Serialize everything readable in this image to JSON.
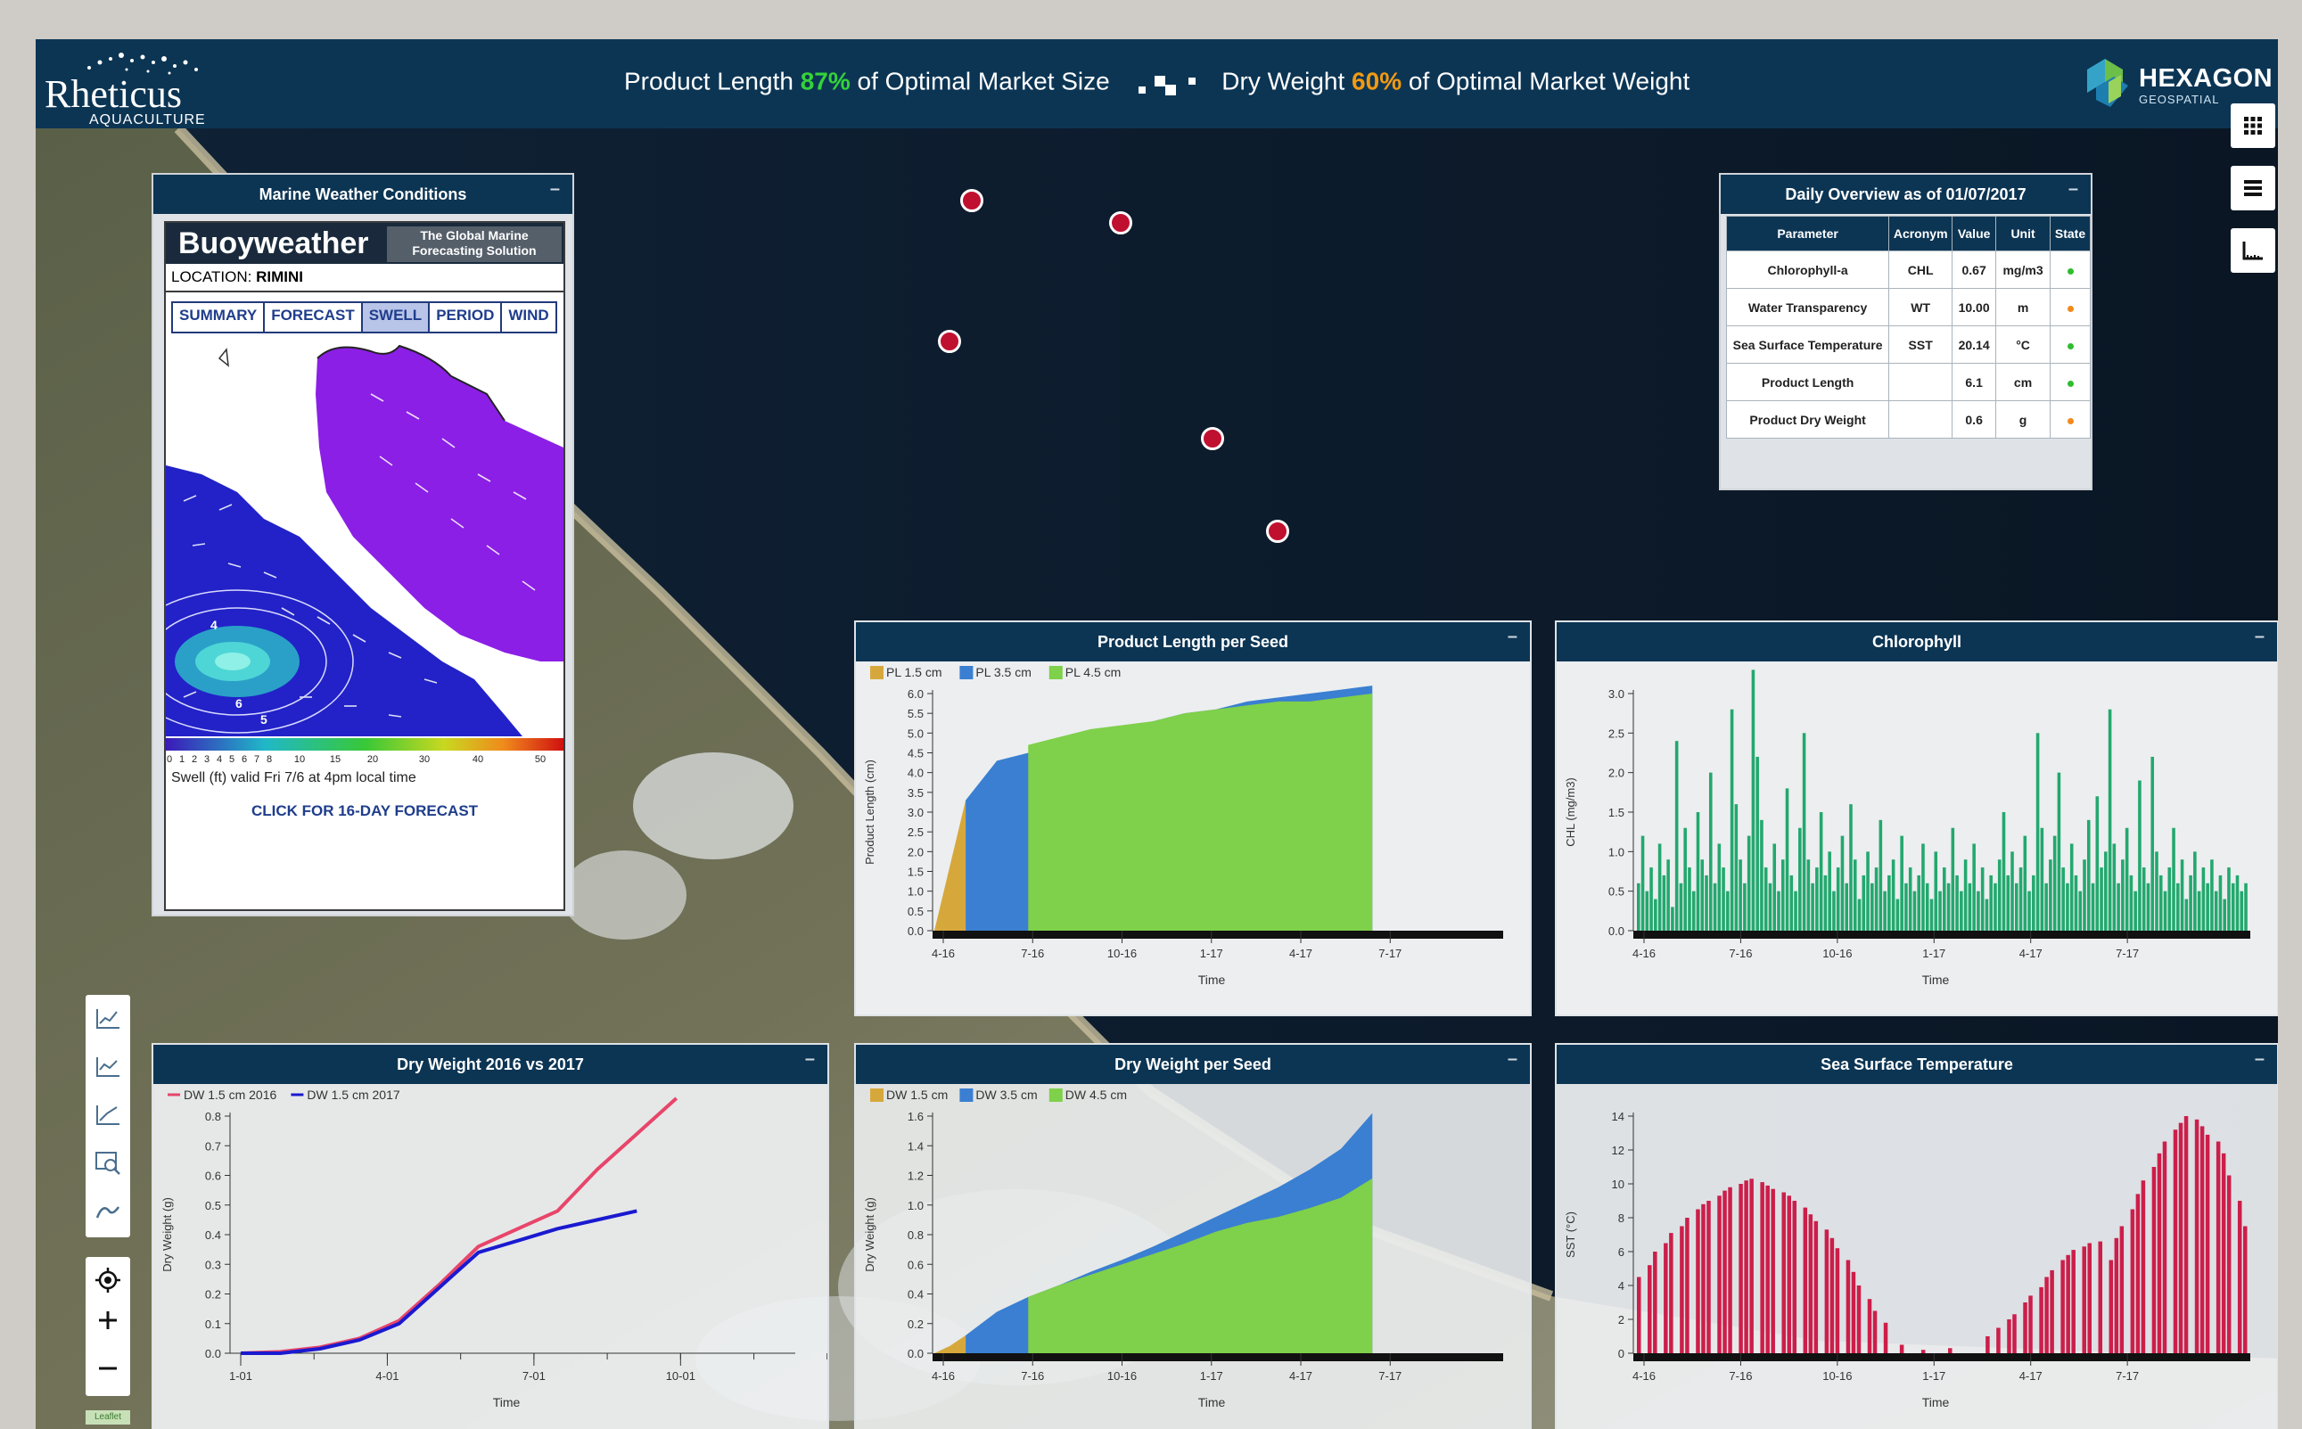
{
  "header": {
    "logo_name": "Rheticus",
    "logo_sub": "AQUACULTURE",
    "length_prefix": "Product Length ",
    "length_pct": "87%",
    "length_suffix": " of Optimal Market Size",
    "weight_prefix": "Dry Weight ",
    "weight_pct": "60%",
    "weight_suffix": " of Optimal Market Weight",
    "partner_logo": "HEXAGON",
    "partner_sub": "GEOSPATIAL"
  },
  "weather": {
    "title": "Marine Weather Conditions",
    "brand": "Buoyweather",
    "tagline_1": "The Global Marine",
    "tagline_2": "Forecasting Solution",
    "location_label": "LOCATION:",
    "location_value": "RIMINI",
    "tabs": [
      "SUMMARY",
      "FORECAST",
      "SWELL",
      "PERIOD",
      "WIND"
    ],
    "selected_tab": "SWELL",
    "scale_ticks": [
      "0",
      "1",
      "2",
      "3",
      "4",
      "5",
      "6",
      "7",
      "8",
      "10",
      "15",
      "20",
      "30",
      "40",
      "50"
    ],
    "contour_labels": [
      "4",
      "6",
      "5"
    ],
    "caption": "Swell (ft) valid Fri 7/6 at 4pm local time",
    "forecast_link": "CLICK FOR 16-DAY FORECAST"
  },
  "overview": {
    "title": "Daily Overview as of 01/07/2017",
    "columns": [
      "Parameter",
      "Acronym",
      "Value",
      "Unit",
      "State"
    ],
    "rows": [
      {
        "parameter": "Chlorophyll-a",
        "acronym": "CHL",
        "value": "0.67",
        "unit": "mg/m3",
        "state": "#2ebd2e"
      },
      {
        "parameter": "Water Transparency",
        "acronym": "WT",
        "value": "10.00",
        "unit": "m",
        "state": "#f08a1c"
      },
      {
        "parameter": "Sea Surface Temperature",
        "acronym": "SST",
        "value": "20.14",
        "unit": "°C",
        "state": "#2ebd2e"
      },
      {
        "parameter": "Product Length",
        "acronym": "",
        "value": "6.1",
        "unit": "cm",
        "state": "#2ebd2e"
      },
      {
        "parameter": "Product Dry Weight",
        "acronym": "",
        "value": "0.6",
        "unit": "g",
        "state": "#f08a1c"
      }
    ]
  },
  "map": {
    "attribution": "Leaflet"
  },
  "panel_titles": {
    "product_length": "Product Length per Seed",
    "chlorophyll": "Chlorophyll",
    "dry_weight_years": "Dry Weight 2016 vs 2017",
    "dry_weight_seed": "Dry Weight per Seed",
    "sst": "Sea Surface Temperature"
  },
  "chart_data": [
    {
      "id": "product_length",
      "type": "area",
      "title": "Product Length per Seed",
      "xlabel": "Time",
      "ylabel": "Product Length (cm)",
      "x_ticks": [
        "4-16",
        "7-16",
        "10-16",
        "1-17",
        "4-17",
        "7-17"
      ],
      "ylim": [
        0,
        6.0
      ],
      "y_ticks": [
        0.0,
        0.5,
        1.0,
        1.5,
        2.0,
        2.5,
        3.0,
        3.5,
        4.0,
        4.5,
        5.0,
        5.5,
        6.0
      ],
      "x_range": [
        0,
        15
      ],
      "series": [
        {
          "name": "PL 1.5 cm",
          "color": "#d6a83c",
          "x": [
            0,
            1.0
          ],
          "y": [
            0.0,
            3.3
          ]
        },
        {
          "name": "PL 3.5 cm",
          "color": "#3a7fd1",
          "x": [
            1.0,
            2.0,
            3.0,
            4.0,
            5.0,
            6.0,
            7.0,
            8.0,
            9.0,
            10.0,
            11.0,
            12.0,
            13.0,
            14.0
          ],
          "y": [
            3.3,
            4.3,
            4.5,
            4.7,
            4.9,
            5.1,
            5.3,
            5.5,
            5.6,
            5.8,
            5.9,
            6.0,
            6.1,
            6.2
          ]
        },
        {
          "name": "PL 4.5 cm",
          "color": "#7fd04a",
          "x": [
            3.0,
            4.0,
            5.0,
            6.0,
            7.0,
            8.0,
            9.0,
            10.0,
            11.0,
            12.0,
            13.0,
            14.0
          ],
          "y": [
            4.7,
            4.9,
            5.1,
            5.2,
            5.3,
            5.5,
            5.6,
            5.7,
            5.8,
            5.8,
            5.9,
            6.0
          ]
        }
      ]
    },
    {
      "id": "chlorophyll",
      "type": "bar",
      "title": "Chlorophyll",
      "xlabel": "Time",
      "ylabel": "CHL (mg/m3)",
      "x_ticks": [
        "4-16",
        "7-16",
        "10-16",
        "1-17",
        "4-17",
        "7-17"
      ],
      "ylim": [
        0,
        3.0
      ],
      "y_ticks": [
        0.0,
        0.5,
        1.0,
        1.5,
        2.0,
        2.5,
        3.0
      ],
      "color": "#23a86e",
      "values": [
        0.6,
        1.2,
        0.5,
        0.8,
        0.4,
        1.1,
        0.7,
        0.9,
        0.3,
        2.4,
        0.6,
        1.3,
        0.8,
        0.5,
        1.5,
        0.9,
        0.7,
        2.0,
        0.6,
        1.1,
        0.8,
        0.5,
        2.8,
        1.6,
        0.9,
        0.6,
        1.2,
        3.3,
        2.2,
        1.4,
        0.8,
        0.6,
        1.1,
        0.5,
        0.9,
        1.8,
        0.7,
        0.5,
        1.3,
        2.5,
        0.9,
        0.6,
        0.8,
        1.5,
        0.7,
        1.0,
        0.5,
        0.8,
        1.2,
        0.6,
        1.6,
        0.9,
        0.4,
        0.7,
        1.0,
        0.6,
        0.8,
        1.4,
        0.5,
        0.7,
        0.9,
        0.4,
        1.2,
        0.6,
        0.8,
        0.5,
        0.7,
        1.1,
        0.6,
        0.4,
        1.0,
        0.5,
        0.8,
        0.6,
        1.3,
        0.7,
        0.5,
        0.9,
        0.6,
        1.1,
        0.5,
        0.8,
        0.4,
        0.7,
        0.6,
        0.9,
        1.5,
        0.7,
        1.0,
        0.6,
        0.8,
        1.2,
        0.5,
        0.7,
        2.5,
        1.3,
        0.6,
        0.9,
        1.2,
        2.0,
        0.8,
        0.6,
        1.1,
        0.7,
        0.5,
        0.9,
        1.4,
        0.6,
        1.7,
        0.8,
        1.0,
        2.8,
        1.1,
        0.6,
        0.9,
        1.3,
        0.7,
        0.5,
        1.9,
        0.8,
        0.6,
        2.2,
        1.0,
        0.7,
        0.5,
        0.8,
        1.3,
        0.6,
        0.9,
        0.4,
        0.7,
        1.0,
        0.5,
        0.8,
        0.6,
        0.9,
        0.5,
        0.7,
        0.4,
        0.8,
        0.6,
        0.7,
        0.5,
        0.6
      ]
    },
    {
      "id": "dry_weight_years",
      "type": "line",
      "title": "Dry Weight 2016 vs 2017",
      "xlabel": "Time",
      "ylabel": "Dry Weight (g)",
      "x_ticks": [
        "1-01",
        "4-01",
        "7-01",
        "10-01"
      ],
      "ylim": [
        0,
        0.8
      ],
      "y_ticks": [
        0.0,
        0.1,
        0.2,
        0.3,
        0.4,
        0.5,
        0.6,
        0.7,
        0.8
      ],
      "x_range": [
        0,
        14
      ],
      "series": [
        {
          "name": "DW 1.5 cm 2016",
          "color": "#e8456a",
          "x": [
            0,
            1,
            2,
            3,
            4,
            5,
            6,
            7,
            8,
            9,
            10,
            11
          ],
          "y": [
            0.0,
            0.005,
            0.02,
            0.05,
            0.11,
            0.23,
            0.36,
            0.42,
            0.48,
            0.62,
            0.74,
            0.86
          ]
        },
        {
          "name": "DW 1.5 cm 2017",
          "color": "#1a1ad0",
          "x": [
            0,
            1,
            2,
            3,
            4,
            5,
            6,
            7,
            8,
            9,
            10
          ],
          "y": [
            0.0,
            0.0,
            0.015,
            0.045,
            0.1,
            0.22,
            0.34,
            0.38,
            0.42,
            0.45,
            0.48
          ]
        }
      ]
    },
    {
      "id": "dry_weight_seed",
      "type": "area",
      "title": "Dry Weight per Seed",
      "xlabel": "Time",
      "ylabel": "Dry Weight (g)",
      "x_ticks": [
        "4-16",
        "7-16",
        "10-16",
        "1-17",
        "4-17",
        "7-17"
      ],
      "ylim": [
        0,
        1.6
      ],
      "y_ticks": [
        0.0,
        0.2,
        0.4,
        0.6,
        0.8,
        1.0,
        1.2,
        1.4,
        1.6
      ],
      "x_range": [
        0,
        15
      ],
      "series": [
        {
          "name": "DW 1.5 cm",
          "color": "#d6a83c",
          "x": [
            0,
            0.5,
            1.0
          ],
          "y": [
            0.0,
            0.05,
            0.12
          ]
        },
        {
          "name": "DW 3.5 cm",
          "color": "#3a7fd1",
          "x": [
            1.0,
            2.0,
            3.0,
            4.0,
            5.0,
            6.0,
            7.0,
            8.0,
            9.0,
            10.0,
            11.0,
            12.0,
            13.0,
            14.0
          ],
          "y": [
            0.12,
            0.28,
            0.38,
            0.46,
            0.55,
            0.63,
            0.72,
            0.82,
            0.92,
            1.02,
            1.12,
            1.24,
            1.38,
            1.62
          ]
        },
        {
          "name": "DW 4.5 cm",
          "color": "#7fd04a",
          "x": [
            3.0,
            4.0,
            5.0,
            6.0,
            7.0,
            8.0,
            9.0,
            10.0,
            11.0,
            12.0,
            13.0,
            14.0
          ],
          "y": [
            0.38,
            0.46,
            0.53,
            0.6,
            0.67,
            0.74,
            0.82,
            0.88,
            0.92,
            0.98,
            1.05,
            1.18
          ]
        }
      ]
    },
    {
      "id": "sst",
      "type": "bar",
      "title": "Sea Surface Temperature",
      "xlabel": "Time",
      "ylabel": "SST (°C)",
      "x_ticks": [
        "4-16",
        "7-16",
        "10-16",
        "1-17",
        "4-17",
        "7-17"
      ],
      "ylim": [
        0,
        14
      ],
      "y_ticks": [
        0,
        2,
        4,
        6,
        8,
        10,
        12,
        14
      ],
      "color": "#cc1e4a",
      "values": [
        4.5,
        0,
        5.2,
        6.0,
        0,
        6.5,
        7.1,
        0,
        7.5,
        8.0,
        0,
        8.5,
        8.8,
        9.0,
        0,
        9.3,
        9.6,
        9.8,
        0,
        10.0,
        10.2,
        10.3,
        0,
        10.1,
        9.9,
        9.7,
        0,
        9.5,
        9.3,
        9.0,
        0,
        8.6,
        8.2,
        7.8,
        0,
        7.3,
        6.8,
        6.2,
        0,
        5.5,
        4.8,
        4.0,
        0,
        3.2,
        2.5,
        0,
        1.8,
        0,
        0,
        0.5,
        0,
        0,
        0,
        0.2,
        0,
        0,
        0,
        0,
        0.3,
        0,
        0,
        0,
        0,
        0,
        0,
        1.0,
        0,
        1.5,
        0,
        2.0,
        2.3,
        0,
        3.0,
        3.4,
        0,
        3.9,
        4.5,
        4.9,
        0,
        5.5,
        5.8,
        6.1,
        0,
        6.3,
        6.5,
        0,
        6.6,
        0,
        5.5,
        6.8,
        7.5,
        0,
        8.5,
        9.4,
        10.2,
        0,
        11.0,
        11.8,
        12.5,
        0,
        13.2,
        13.6,
        14.0,
        0,
        13.8,
        13.4,
        12.9,
        0,
        12.5,
        11.8,
        10.5,
        0,
        9.0,
        7.5
      ]
    }
  ]
}
